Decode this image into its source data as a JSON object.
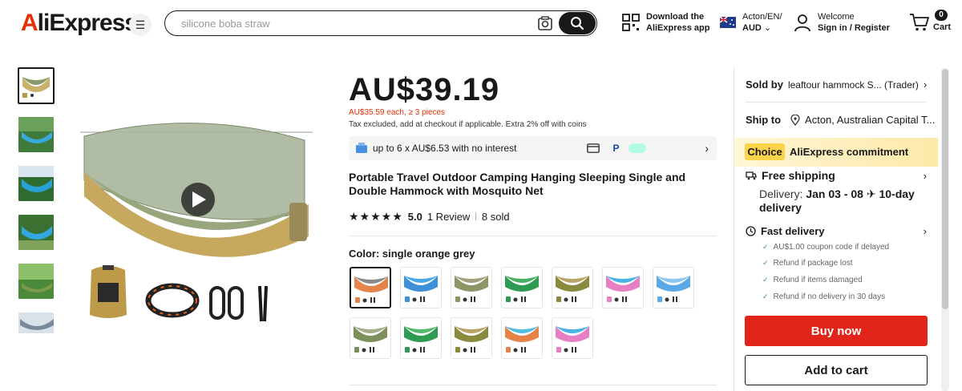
{
  "header": {
    "logo": "AliExpress",
    "search_placeholder": "silicone boba straw",
    "download_line1": "Download the",
    "download_line2": "AliExpress app",
    "locale_line1": "Acton/EN/",
    "locale_line2": "AUD",
    "welcome": "Welcome",
    "signin": "Sign in / Register",
    "cart_count": "0",
    "cart_label": "Cart"
  },
  "product": {
    "price": "AU$39.19",
    "bulk_price": "AU$35.59 each, ≥ 3 pieces",
    "tax_note": "Tax excluded, add at checkout if applicable. Extra 2% off with coins",
    "installments": "up to 6 x AU$6.53 with no interest",
    "title": "Portable Travel Outdoor Camping Hanging Sleeping Single and Double Hammock with Mosquito Net",
    "rating": "5.0",
    "reviews": "1 Review",
    "sold": "8 sold",
    "color_label": "Color: single orange grey",
    "swatches_row1": [
      {
        "hammock": "#e4834a",
        "net": "#8a8a8a"
      },
      {
        "hammock": "#3d8fd8",
        "net": "#4aa8e8"
      },
      {
        "hammock": "#8c9566",
        "net": "#a3a07f"
      },
      {
        "hammock": "#2f9a52",
        "net": "#48b063"
      },
      {
        "hammock": "#8a8a3e",
        "net": "#b9a46a"
      },
      {
        "hammock": "#e77fc4",
        "net": "#49b3e6"
      },
      {
        "hammock": "#5aa9e6",
        "net": "#8bc6f0"
      }
    ],
    "swatches_row2": [
      {
        "hammock": "#7d8f5a",
        "net": "#a5ad8a"
      },
      {
        "hammock": "#2f9a52",
        "net": "#52bb6a"
      },
      {
        "hammock": "#8a8a3e",
        "net": "#b9a46a"
      },
      {
        "hammock": "#e4834a",
        "net": "#52bde0"
      },
      {
        "hammock": "#e77fc4",
        "net": "#49b3e6"
      }
    ]
  },
  "sidebar": {
    "sold_by_label": "Sold by",
    "seller": "leaftour hammock S... (Trader)",
    "ship_to_label": "Ship to",
    "ship_to": "Acton, Australian Capital T...",
    "choice": "Choice",
    "commitment": "AliExpress commitment",
    "free_shipping": "Free shipping",
    "delivery_prefix": "Delivery:",
    "delivery_dates": "Jan 03 - 08",
    "delivery_speed": "10-day delivery",
    "fast_delivery": "Fast delivery",
    "guarantees": [
      "AU$1.00 coupon code if delayed",
      "Refund if package lost",
      "Refund if items damaged",
      "Refund if no delivery in 30 days"
    ],
    "buy_now": "Buy now",
    "add_to_cart": "Add to cart"
  },
  "colors": {
    "accent_red": "#e1251b",
    "price_red": "#e62e04",
    "choice_yellow": "#fbd44a"
  }
}
